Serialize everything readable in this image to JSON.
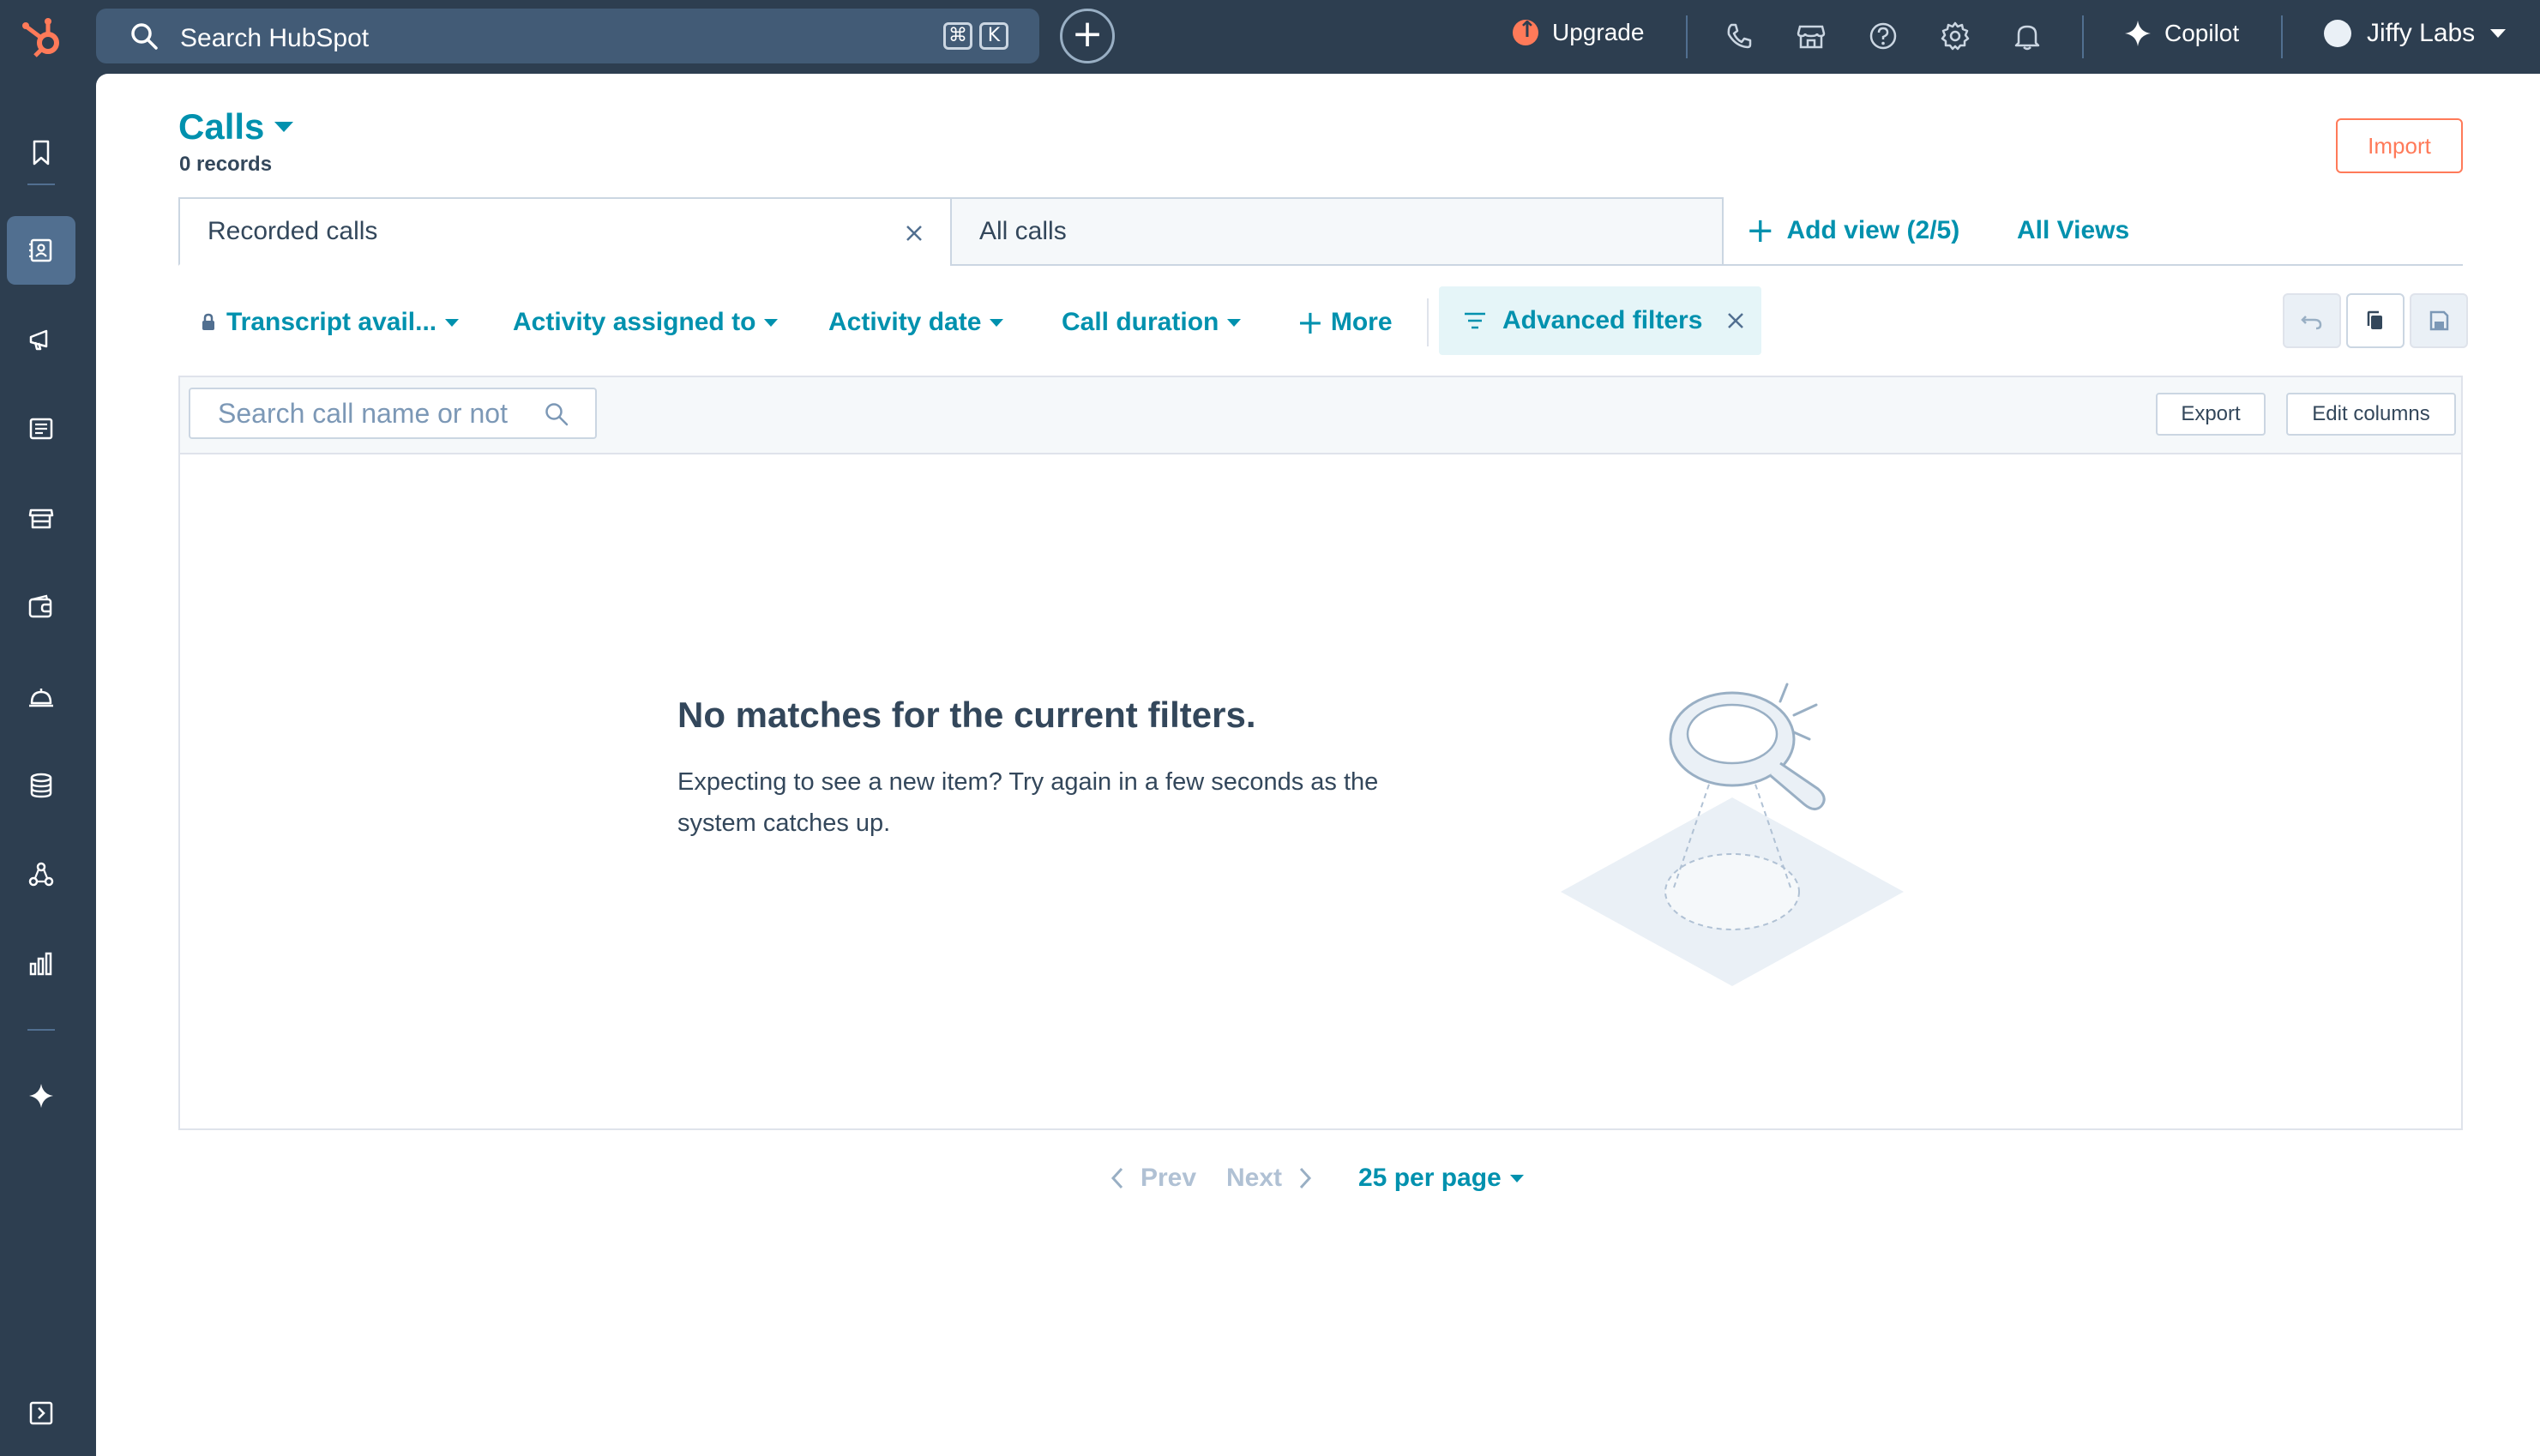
{
  "topbar": {
    "search_placeholder": "Search HubSpot",
    "shortcut_key1": "⌘",
    "shortcut_key2": "K",
    "upgrade_label": "Upgrade",
    "copilot_label": "Copilot",
    "account_name": "Jiffy Labs",
    "icons": [
      "hubspot-logo",
      "search-icon",
      "plus-icon",
      "phone-icon",
      "marketplace-icon",
      "help-icon",
      "settings-icon",
      "notifications-icon",
      "copilot-icon"
    ]
  },
  "sidebar": {
    "items": [
      "bookmark",
      "contacts",
      "marketing",
      "content",
      "commerce",
      "sales",
      "service",
      "data-management",
      "automation",
      "reporting",
      "breeze",
      "expand"
    ]
  },
  "header": {
    "title": "Calls",
    "record_count": "0 records",
    "import_label": "Import"
  },
  "views": {
    "tabs": [
      {
        "label": "Recorded calls"
      },
      {
        "label": "All calls"
      }
    ],
    "add_view_label": "Add view (2/5)",
    "all_views_label": "All Views"
  },
  "filters": {
    "items": [
      "Transcript avail...",
      "Activity assigned to",
      "Activity date",
      "Call duration"
    ],
    "more_label": "More",
    "advanced_label": "Advanced filters"
  },
  "table": {
    "search_placeholder": "Search call name or not",
    "export_label": "Export",
    "edit_columns_label": "Edit columns",
    "empty_title": "No matches for the current filters.",
    "empty_body": "Expecting to see a new item? Try again in a few seconds as the system catches up."
  },
  "pagination": {
    "prev_label": "Prev",
    "next_label": "Next",
    "per_page_label": "25 per page"
  },
  "colors": {
    "nav_bg": "#2d3e50",
    "accent": "#0091ae",
    "import_orange": "#ff7a59",
    "active_filter_bg": "#e5f5f8"
  }
}
